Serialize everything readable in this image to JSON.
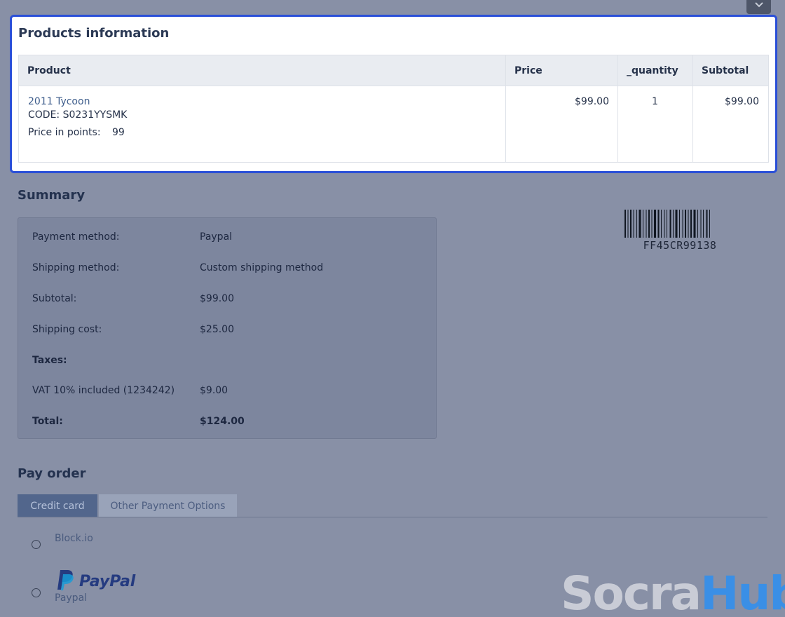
{
  "products": {
    "title": "Products information",
    "columns": [
      "Product",
      "Price",
      "_quantity",
      "Subtotal"
    ],
    "rows": [
      {
        "name": "2011 Tycoon",
        "code": "CODE: S0231YYSMK",
        "points_label": "Price in points:",
        "points_value": "99",
        "price": "$99.00",
        "quantity": "1",
        "subtotal": "$99.00"
      }
    ]
  },
  "summary": {
    "title": "Summary",
    "rows": [
      {
        "label": "Payment method:",
        "value": "Paypal"
      },
      {
        "label": "Shipping method:",
        "value": "Custom shipping method"
      },
      {
        "label": "Subtotal:",
        "value": "$99.00"
      },
      {
        "label": "Shipping cost:",
        "value": "$25.00"
      },
      {
        "label": "Taxes:",
        "value": ""
      },
      {
        "label": "VAT 10% included (1234242)",
        "value": "$9.00"
      },
      {
        "label": "Total:",
        "value": "$124.00"
      }
    ]
  },
  "barcode": {
    "text": "FF45CR99138"
  },
  "pay_order": {
    "title": "Pay order",
    "tabs": [
      {
        "label": "Credit card",
        "active": true
      },
      {
        "label": "Other Payment Options",
        "active": false
      }
    ],
    "methods": [
      {
        "label": "Block.io"
      },
      {
        "label": "Paypal",
        "logo_text": "PayPal"
      }
    ]
  },
  "watermark": {
    "part1": "Socra",
    "part2": "Hub"
  },
  "colors": {
    "accent_border": "#2a4fd8",
    "link": "#3f5e8c",
    "paypal_dark": "#253b80",
    "paypal_light": "#179bd7",
    "watermark_blue": "#3a8fe6"
  },
  "icons": {
    "collapse": "chevron-down-icon",
    "paypal": "paypal-logo-icon"
  }
}
